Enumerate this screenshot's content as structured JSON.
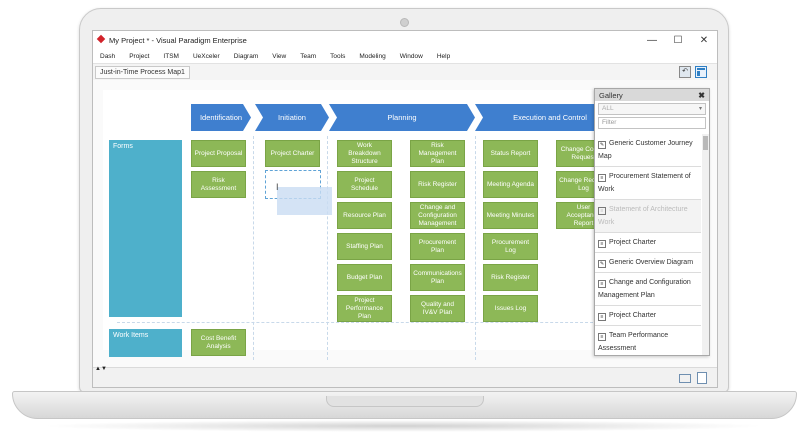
{
  "window": {
    "title": "My Project * - Visual Paradigm Enterprise",
    "controls": {
      "minimize": "—",
      "maximize": "☐",
      "close": "✕"
    }
  },
  "menu": [
    "Dash",
    "Project",
    "ITSM",
    "UeXceler",
    "Diagram",
    "View",
    "Team",
    "Tools",
    "Modeling",
    "Window",
    "Help"
  ],
  "tab": {
    "label": "Just-in-Time Process Map1"
  },
  "phases": [
    "Identification",
    "Initiation",
    "Planning",
    "Execution and Control"
  ],
  "lanes": {
    "forms": "Forms",
    "work_items": "Work Items"
  },
  "boxes": {
    "identification": [
      "Project Proposal",
      "Risk Assessment"
    ],
    "initiation": [
      "Project Charter"
    ],
    "planning_a": [
      "Work Breakdown Structure",
      "Project Schedule",
      "Resource Plan",
      "Staffing Plan",
      "Budget Plan",
      "Project Performance Plan"
    ],
    "planning_b": [
      "Risk Management Plan",
      "Risk Register",
      "Change and Configuration Management",
      "Procurement Plan",
      "Communications Plan",
      "Quality and IV&V Plan"
    ],
    "execution_a": [
      "Status Report",
      "Meeting Agenda",
      "Meeting Minutes",
      "Procurement Log",
      "Risk Register",
      "Issues Log"
    ],
    "execution_b": [
      "Change Control Request",
      "Change Request Log",
      "User Acceptance Report"
    ],
    "work_items": [
      "Cost Benefit Analysis"
    ]
  },
  "gallery": {
    "title": "Gallery",
    "close": "✖",
    "dropdown": "ALL",
    "filter_placeholder": "Filter",
    "items": [
      {
        "label": "Generic Customer Journey Map",
        "icon": "✎",
        "disabled": false
      },
      {
        "label": "Procurement Statement of Work",
        "icon": "≡",
        "disabled": false
      },
      {
        "label": "Statement of Architecture Work",
        "icon": "≡",
        "disabled": true
      },
      {
        "label": "Project Charter",
        "icon": "≡",
        "disabled": false
      },
      {
        "label": "Generic Overview Diagram",
        "icon": "✎",
        "disabled": false
      },
      {
        "label": "Change and Configuration Management Plan",
        "icon": "≡",
        "disabled": false
      },
      {
        "label": "Project Charter",
        "icon": "≡",
        "disabled": false
      },
      {
        "label": "Team Performance Assessment",
        "icon": "≡",
        "disabled": false
      }
    ]
  },
  "colors": {
    "phase": "#3f7fcf",
    "lane": "#4eb0cb",
    "box": "#8db857"
  }
}
